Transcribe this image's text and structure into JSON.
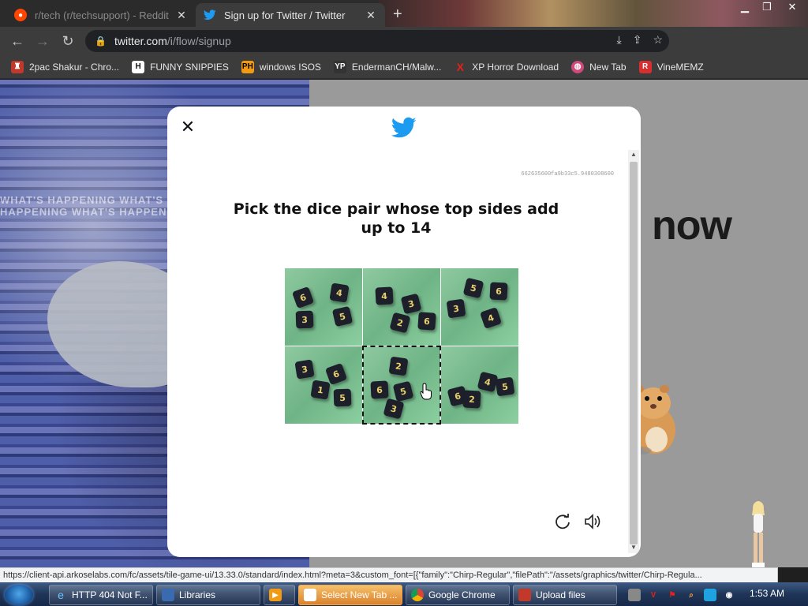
{
  "browser": {
    "tabs": [
      {
        "title": "r/tech (r/techsupport) - Reddit",
        "active": false,
        "favicon": "reddit-icon"
      },
      {
        "title": "Sign up for Twitter / Twitter",
        "active": true,
        "favicon": "twitter-icon"
      }
    ],
    "new_tab_label": "+",
    "url_host": "twitter.com",
    "url_path": "/i/flow/signup",
    "bookmarks": [
      {
        "label": "2pac Shakur - Chro...",
        "icon": "bookmark-icon",
        "icon_text": "",
        "color": "#c0392b"
      },
      {
        "label": "FUNNY SNIPPIES",
        "icon": "h-icon",
        "icon_text": "H",
        "color": "#222222"
      },
      {
        "label": "windows ISOS",
        "icon": "ph-icon",
        "icon_text": "PH",
        "color": "#f29b12"
      },
      {
        "label": "EndermanCH/Malw...",
        "icon": "yt-icon",
        "icon_text": "YP",
        "color": "#333333"
      },
      {
        "label": "XP Horror Download",
        "icon": "x-icon",
        "icon_text": "X",
        "color": "#e62117"
      },
      {
        "label": "New Tab",
        "icon": "globe-icon",
        "icon_text": "",
        "color": "#cf4a7a"
      },
      {
        "label": "VineMEMZ",
        "icon": "r-icon",
        "icon_text": "R",
        "color": "#d62f2f"
      }
    ]
  },
  "page": {
    "hero_text": "WHAT'S HAPPENING WHAT'S HAPPENING WHAT'S HAPPENING WHAT'S HAPPENING",
    "now_text": "now"
  },
  "captcha": {
    "session_id": "662635600fa9b33c5.9480308600",
    "prompt": "Pick the dice pair whose top sides add up to 14",
    "selected_tile": 4,
    "tiles": [
      {
        "dice": [
          {
            "v": "6"
          },
          {
            "v": "4"
          },
          {
            "v": "3"
          },
          {
            "v": "5"
          }
        ]
      },
      {
        "dice": [
          {
            "v": "4"
          },
          {
            "v": "3"
          },
          {
            "v": "2"
          },
          {
            "v": "6"
          }
        ]
      },
      {
        "dice": [
          {
            "v": "5"
          },
          {
            "v": "6"
          },
          {
            "v": "3"
          },
          {
            "v": "4"
          }
        ]
      },
      {
        "dice": [
          {
            "v": "3"
          },
          {
            "v": "6"
          },
          {
            "v": "1"
          },
          {
            "v": "5"
          }
        ]
      },
      {
        "dice": [
          {
            "v": "2"
          },
          {
            "v": "6"
          },
          {
            "v": "5"
          },
          {
            "v": "3"
          }
        ]
      },
      {
        "dice": [
          {
            "v": "6"
          },
          {
            "v": "4"
          },
          {
            "v": "2"
          },
          {
            "v": "5"
          }
        ]
      }
    ]
  },
  "status_bar": {
    "url": "https://client-api.arkoselabs.com/fc/assets/tile-game-ui/13.33.0/standard/index.html?meta=3&custom_font=[{\"family\":\"Chirp-Regular\",\"filePath\":\"/assets/graphics/twitter/Chirp-Regula..."
  },
  "taskbar": {
    "items": [
      {
        "label": "HTTP 404 Not F...",
        "icon": "ie-icon",
        "highlighted": false
      },
      {
        "label": "Libraries",
        "icon": "folder-icon",
        "highlighted": false
      },
      {
        "label": "",
        "icon": "media-icon",
        "highlighted": false
      },
      {
        "label": "Select New Tab ...",
        "icon": "chrome-window-icon",
        "highlighted": true
      },
      {
        "label": "Google Chrome",
        "icon": "chrome-icon",
        "highlighted": false
      },
      {
        "label": "Upload files",
        "icon": "upload-icon",
        "highlighted": false
      }
    ],
    "clock": "1:53 AM"
  },
  "colors": {
    "twitter_blue": "#1d9bf0",
    "dice_body": "#1d1f2b",
    "dice_pip": "#e8d06a",
    "tile_green": "#7fbf93"
  }
}
